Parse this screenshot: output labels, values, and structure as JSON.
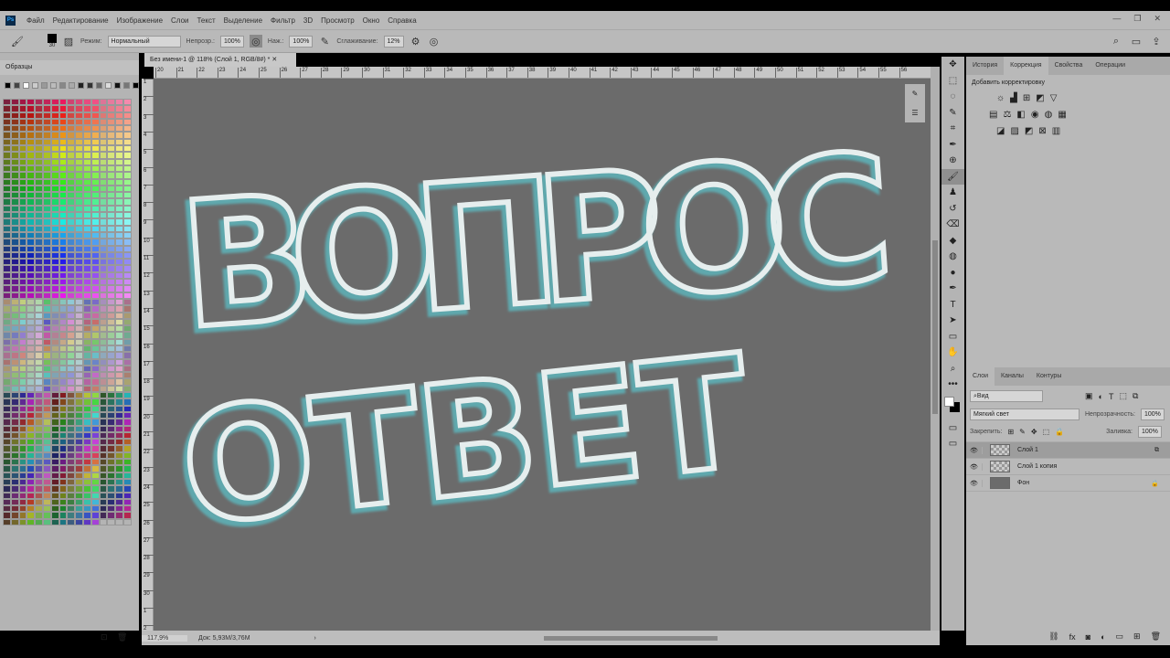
{
  "menu": [
    "Файл",
    "Редактирование",
    "Изображение",
    "Слои",
    "Текст",
    "Выделение",
    "Фильтр",
    "3D",
    "Просмотр",
    "Окно",
    "Справка"
  ],
  "app_logo": "Ps",
  "options": {
    "brush_size": "30",
    "mode_label": "Режим:",
    "mode_value": "Нормальный",
    "opacity_label": "Непрозр.:",
    "opacity_value": "100%",
    "flow_label": "Наж.:",
    "flow_value": "100%",
    "smoothing_label": "Сглаживание:",
    "smoothing_value": "12%"
  },
  "swatches_title": "Образцы",
  "document_tab": "Без имени-1 @ 118% (Слой 1, RGB/8#) *",
  "ruler_h": [
    "20",
    "21",
    "22",
    "23",
    "24",
    "25",
    "26",
    "27",
    "28",
    "29",
    "30",
    "31",
    "32",
    "33",
    "34",
    "35",
    "36",
    "37",
    "38",
    "39",
    "40",
    "41",
    "42",
    "43",
    "44",
    "45",
    "46",
    "47",
    "48",
    "49",
    "50",
    "51",
    "52",
    "53",
    "54",
    "55",
    "56"
  ],
  "ruler_v": [
    "1",
    "2",
    "3",
    "4",
    "5",
    "6",
    "7",
    "8",
    "9",
    "10",
    "11",
    "12",
    "13",
    "14",
    "15",
    "16",
    "17",
    "18",
    "19",
    "20",
    "21",
    "22",
    "23",
    "24",
    "25",
    "26",
    "27",
    "28",
    "29",
    "30",
    "1",
    "2"
  ],
  "canvas_text": [
    "ВОПРОС",
    "ОТВЕТ"
  ],
  "status": {
    "zoom": "117,9%",
    "doc": "Док: 5,93M/3,76M"
  },
  "adjust_panel": {
    "tabs": [
      "История",
      "Коррекция",
      "Свойства",
      "Операции"
    ],
    "active": 1,
    "title": "Добавить корректировку"
  },
  "layers_panel": {
    "tabs": [
      "Слои",
      "Каналы",
      "Контуры"
    ],
    "filter": "Вид",
    "blend": "Мягкий свет",
    "opacity_label": "Непрозрачность:",
    "opacity": "100%",
    "lock_label": "Закрепить:",
    "fill_label": "Заливка:",
    "fill": "100%",
    "layers": [
      {
        "name": "Слой 1",
        "selected": true
      },
      {
        "name": "Слой 1 копия",
        "selected": false
      },
      {
        "name": "Фон",
        "selected": false
      }
    ]
  }
}
